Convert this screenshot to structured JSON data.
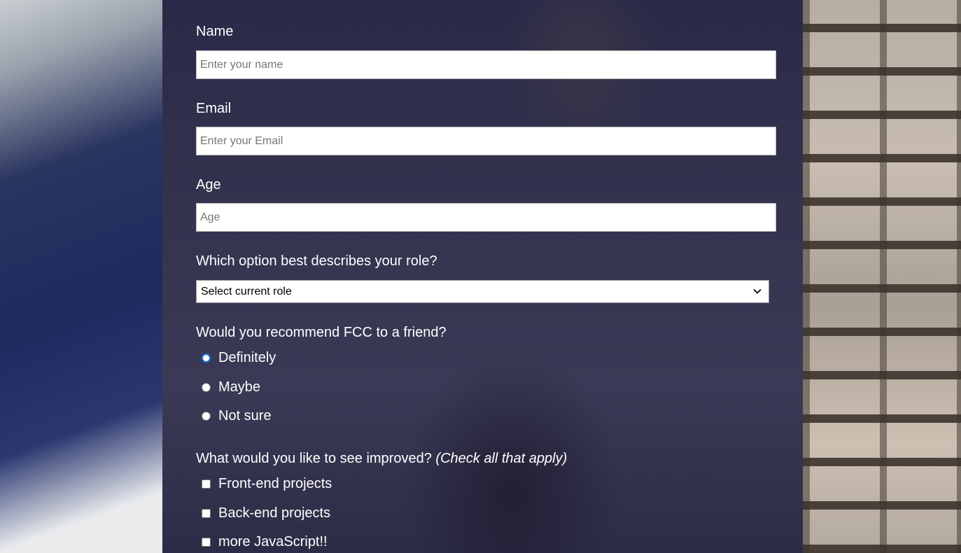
{
  "form": {
    "name": {
      "label": "Name",
      "placeholder": "Enter your name",
      "value": ""
    },
    "email": {
      "label": "Email",
      "placeholder": "Enter your Email",
      "value": ""
    },
    "age": {
      "label": "Age",
      "placeholder": "Age",
      "value": ""
    },
    "role": {
      "label": "Which option best describes your role?",
      "selected": "Select current role"
    },
    "recommend": {
      "label": "Would you recommend FCC to a friend?",
      "options": [
        "Definitely",
        "Maybe",
        "Not sure"
      ],
      "checked": "Definitely"
    },
    "improve": {
      "label": "What would you like to see improved?",
      "hint": "(Check all that apply)",
      "options": [
        "Front-end projects",
        "Back-end projects",
        "more JavaScript!!"
      ]
    }
  },
  "colors": {
    "panel": "#2f2f4c",
    "focus_radio": "#1a73e8"
  }
}
